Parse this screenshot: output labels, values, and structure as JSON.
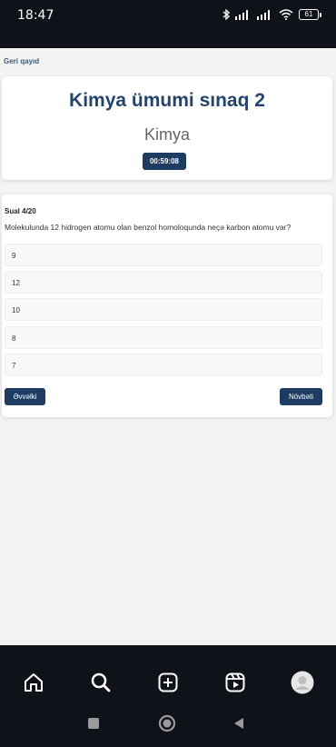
{
  "status_bar": {
    "time": "18:47",
    "battery": "61",
    "icons": [
      "bluetooth-icon",
      "signal-icon",
      "signal-icon",
      "wifi-icon",
      "battery-icon"
    ]
  },
  "page": {
    "back_link": "Geri qayıd",
    "title": "Kimya ümumi sınaq 2",
    "subject": "Kimya",
    "timer": "00:59:08"
  },
  "question": {
    "number_label": "Sual 4/20",
    "text": "Molekulunda 12 hidrogen atomu olan benzol homoloqunda neçə karbon atomu var?",
    "options": [
      "9",
      "12",
      "10",
      "8",
      "7"
    ]
  },
  "buttons": {
    "prev": "Əvvəlki",
    "next": "Növbəti"
  },
  "bottom_nav": {
    "items": [
      "home-icon",
      "search-icon",
      "create-icon",
      "reels-icon",
      "profile-avatar"
    ]
  },
  "system_nav": [
    "recents-button",
    "home-button",
    "back-button"
  ]
}
